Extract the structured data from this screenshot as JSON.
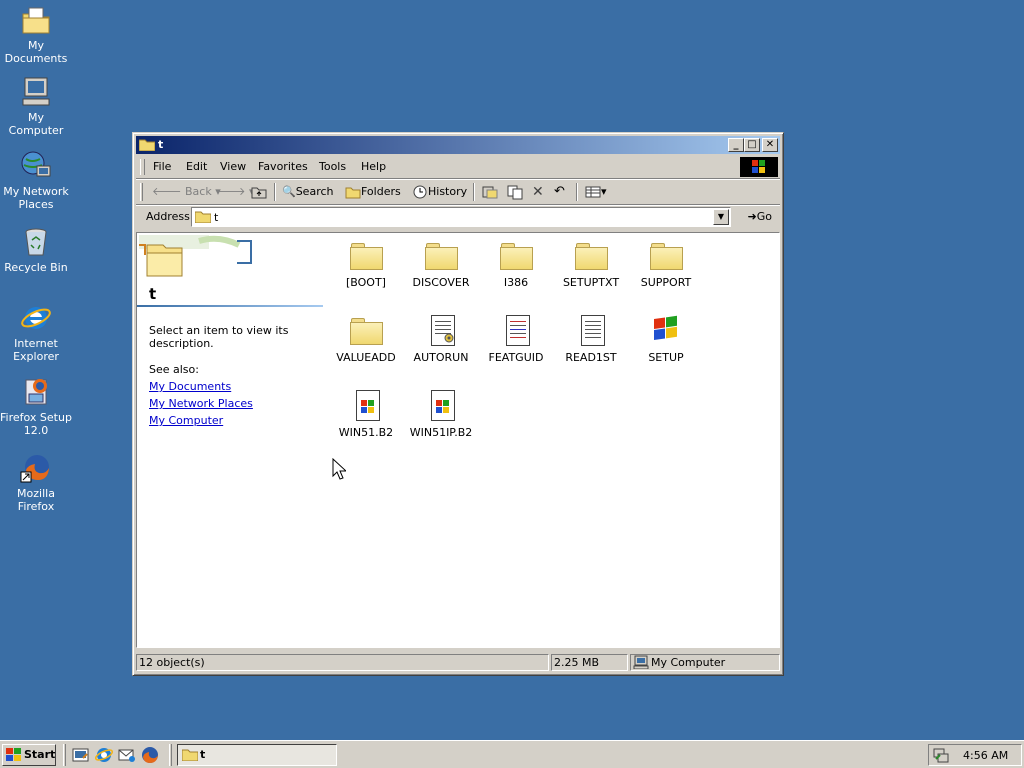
{
  "desktop": {
    "icons": [
      {
        "label": "My Documents"
      },
      {
        "label": "My Computer"
      },
      {
        "label": "My Network Places"
      },
      {
        "label": "Recycle Bin"
      },
      {
        "label": "Internet Explorer"
      },
      {
        "label": "Firefox Setup 12.0"
      },
      {
        "label": "Mozilla Firefox"
      }
    ],
    "background": "#3a6ea5"
  },
  "window": {
    "title": "t",
    "menu": [
      "File",
      "Edit",
      "View",
      "Favorites",
      "Tools",
      "Help"
    ],
    "toolbar": {
      "back": "Back",
      "search": "Search",
      "folders": "Folders",
      "history": "History"
    },
    "address": {
      "label": "Address",
      "value": "t",
      "go": "Go"
    },
    "leftpane": {
      "title": "t",
      "description": "Select an item to view its description.",
      "see_also": "See also:",
      "links": [
        "My Documents",
        "My Network Places",
        "My Computer"
      ]
    },
    "files": [
      {
        "name": "[BOOT]",
        "type": "folder"
      },
      {
        "name": "DISCOVER",
        "type": "folder"
      },
      {
        "name": "I386",
        "type": "folder"
      },
      {
        "name": "SETUPTXT",
        "type": "folder"
      },
      {
        "name": "SUPPORT",
        "type": "folder"
      },
      {
        "name": "VALUEADD",
        "type": "folder"
      },
      {
        "name": "AUTORUN",
        "type": "doc"
      },
      {
        "name": "FEATGUID",
        "type": "doc"
      },
      {
        "name": "READ1ST",
        "type": "doc"
      },
      {
        "name": "SETUP",
        "type": "app"
      },
      {
        "name": "WIN51.B2",
        "type": "winfile"
      },
      {
        "name": "WIN51IP.B2",
        "type": "winfile"
      }
    ],
    "status": {
      "objects": "12 object(s)",
      "size": "2.25 MB",
      "zone": "My Computer"
    }
  },
  "taskbar": {
    "start": "Start",
    "task": "t",
    "clock": "4:56 AM"
  },
  "colors": {
    "title_gradient_start": "#0a246a",
    "title_gradient_end": "#a6caf0",
    "face": "#d4d0c8",
    "link": "#0000cc"
  }
}
